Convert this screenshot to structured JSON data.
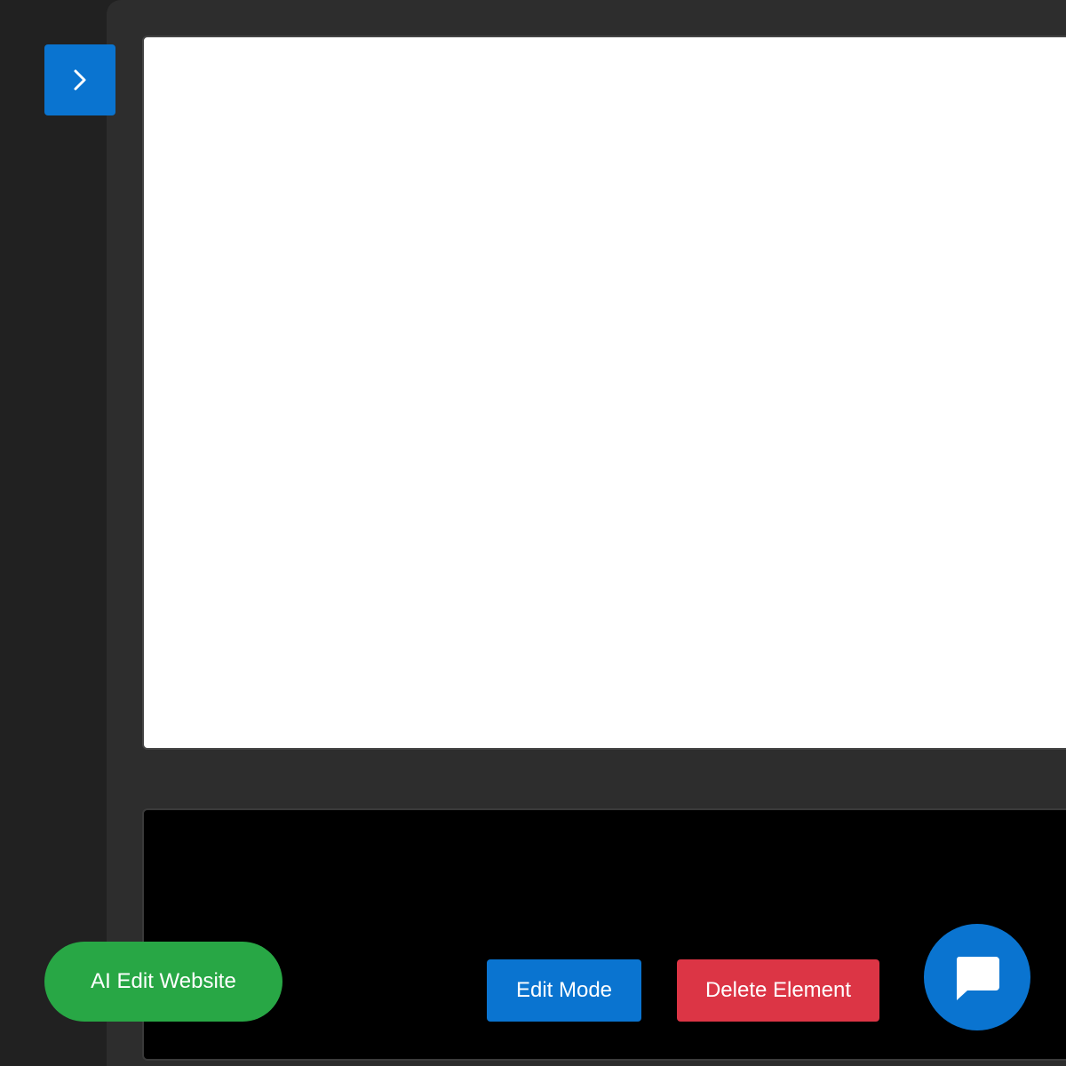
{
  "sidebar": {
    "toggle_icon": "chevron-right-icon"
  },
  "toolbar": {
    "ai_edit_label": "AI Edit Website",
    "edit_mode_label": "Edit Mode",
    "delete_label": "Delete Element"
  },
  "chat": {
    "icon": "chat-bubble-icon"
  },
  "colors": {
    "primary": "#0a74d0",
    "success": "#28a745",
    "danger": "#dc3545",
    "workspace": "#2d2d2d",
    "rail": "#212121"
  }
}
